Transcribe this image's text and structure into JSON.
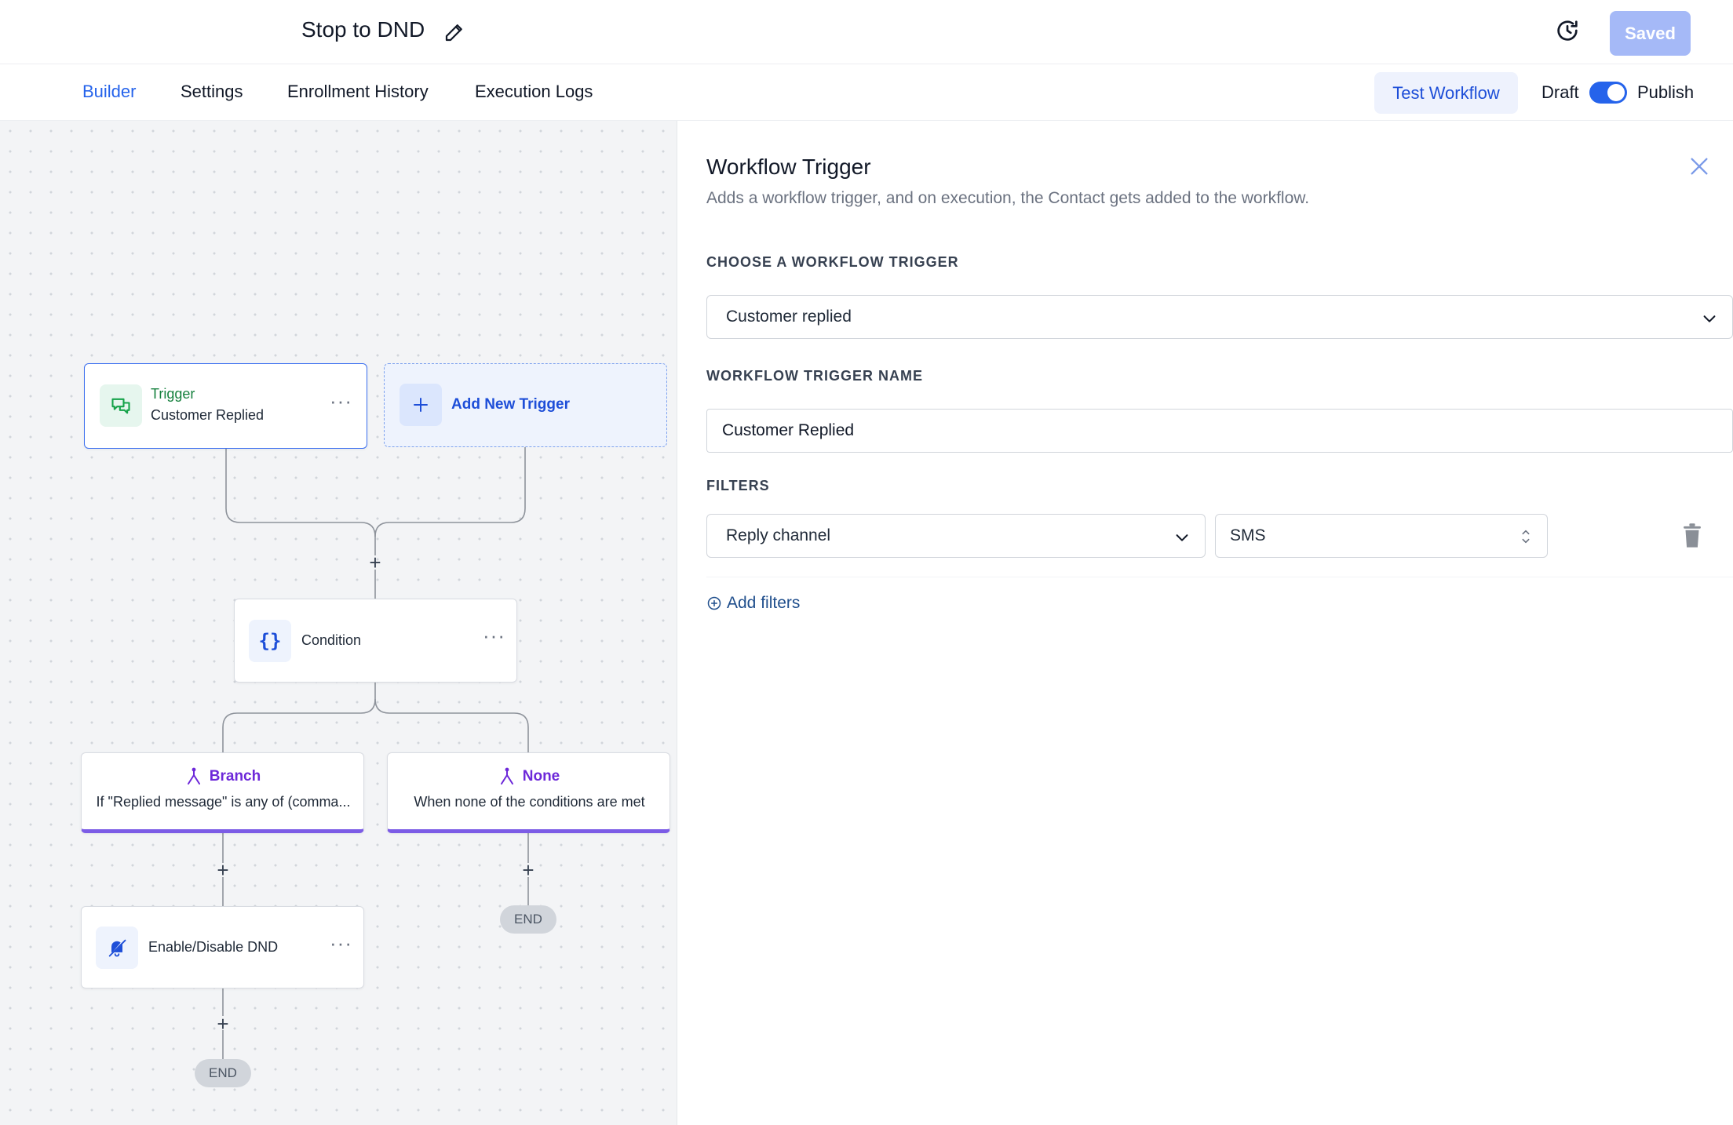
{
  "header": {
    "workflow_title": "Stop to DND",
    "saved_label": "Saved"
  },
  "nav": {
    "tabs": [
      {
        "label": "Builder",
        "active": true
      },
      {
        "label": "Settings",
        "active": false
      },
      {
        "label": "Enrollment History",
        "active": false
      },
      {
        "label": "Execution Logs",
        "active": false
      }
    ],
    "test_workflow_label": "Test Workflow",
    "draft_label": "Draft",
    "publish_label": "Publish",
    "publish_toggle_on": true
  },
  "canvas": {
    "trigger": {
      "kind": "Trigger",
      "name": "Customer Replied",
      "icon": "chat-bubbles-icon"
    },
    "add_trigger_label": "Add New Trigger",
    "condition": {
      "label": "Condition",
      "icon": "curly-braces-icon"
    },
    "branches": [
      {
        "title": "Branch",
        "description": "If \"Replied message\" is any of (comma..."
      },
      {
        "title": "None",
        "description": "When none of the conditions are met"
      }
    ],
    "dnd_action": {
      "label": "Enable/Disable DND",
      "icon": "bell-off-icon"
    },
    "end_label": "END"
  },
  "panel": {
    "title": "Workflow Trigger",
    "subtitle": "Adds a workflow trigger, and on execution, the Contact gets added to the workflow.",
    "choose_trigger_label": "CHOOSE A WORKFLOW TRIGGER",
    "selected_trigger": "Customer replied",
    "trigger_name_label": "WORKFLOW TRIGGER NAME",
    "trigger_name_value": "Customer Replied",
    "filters_label": "FILTERS",
    "filter_field": "Reply channel",
    "filter_value": "SMS",
    "add_filters_label": "Add filters"
  },
  "colors": {
    "accent": "#2563eb",
    "branch_purple": "#7c5ce6",
    "trigger_green": "#15803d",
    "saved_button": "#a5b9f7"
  }
}
